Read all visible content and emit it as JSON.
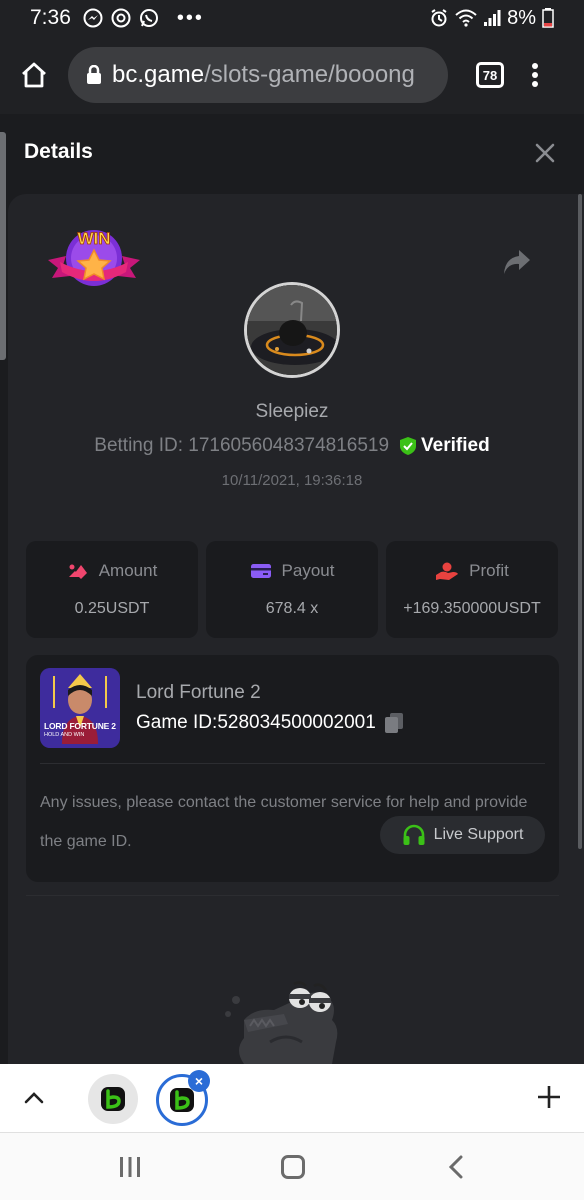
{
  "status_bar": {
    "time": "7:36",
    "battery": "8%",
    "more": "•••"
  },
  "browser": {
    "url_host": "bc.game",
    "url_path": "/slots-game/booong",
    "tab_count": "78"
  },
  "details": {
    "title": "Details",
    "username": "Sleepiez",
    "betting_id_label": "Betting ID: 1716056048374816519",
    "verified_label": "Verified",
    "datetime": "10/11/2021, 19:36:18"
  },
  "stats": [
    {
      "label": "Amount",
      "value": "0.25USDT",
      "color": "#f0466e"
    },
    {
      "label": "Payout",
      "value": "678.4 x",
      "color": "#8b5cf6"
    },
    {
      "label": "Profit",
      "value": "+169.350000USDT",
      "color": "#e8423f"
    }
  ],
  "game": {
    "name": "Lord Fortune 2",
    "game_id_label": "Game ID:",
    "game_id": "528034500002001",
    "thumb_title": "LORD FORTUNE 2",
    "thumb_subtitle": "HOLD AND WIN",
    "issues_text": "Any issues, please contact the customer service for help and provide the game ID.",
    "live_support_label": "Live Support"
  },
  "tabs": {
    "close_label": "×"
  },
  "colors": {
    "accent_green": "#3bc117",
    "tab_active_blue": "#2a6cd6"
  }
}
